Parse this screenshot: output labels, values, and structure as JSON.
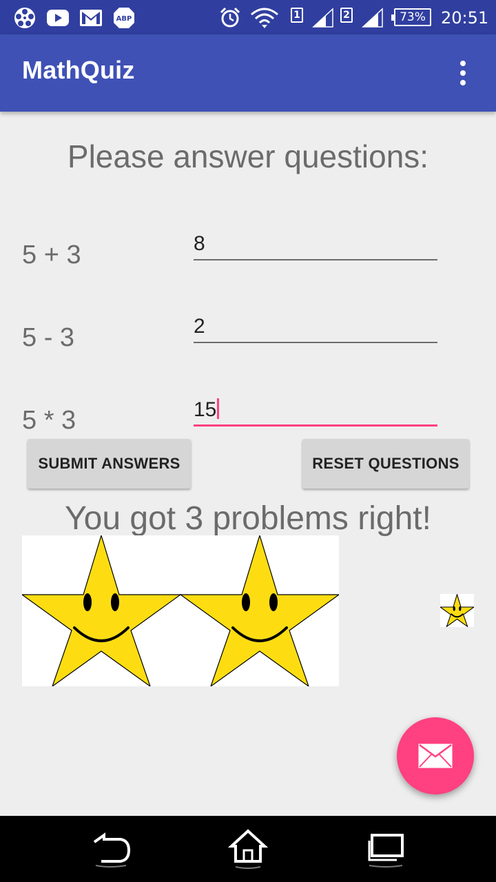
{
  "status_bar": {
    "left_icons": [
      "film-reel-icon",
      "youtube-icon",
      "gmail-icon",
      "adblock-icon"
    ],
    "sim1": "1",
    "sim2": "2",
    "battery": "73%",
    "time": "20:51"
  },
  "app_bar": {
    "title": "MathQuiz",
    "overflow_icon": "more-vert-icon"
  },
  "quiz": {
    "heading": "Please answer questions:",
    "questions": [
      {
        "label": "5 + 3",
        "answer": "8"
      },
      {
        "label": "5 - 3",
        "answer": "2"
      },
      {
        "label": "5 * 3",
        "answer": "15"
      }
    ],
    "submit_label": "SUBMIT ANSWERS",
    "reset_label": "RESET QUESTIONS",
    "result": "You got 3 problems right!",
    "stars": [
      "smiley-star-icon",
      "smiley-star-icon",
      "smiley-star-icon"
    ]
  },
  "fab": {
    "icon": "mail-icon"
  },
  "nav_bar": {
    "icons": [
      "back-icon",
      "home-icon",
      "recents-icon"
    ]
  },
  "colors": {
    "primary": "#3f51b5",
    "primary_dark": "#303f9f",
    "accent": "#ff4081",
    "star_fill": "#fddd12"
  }
}
